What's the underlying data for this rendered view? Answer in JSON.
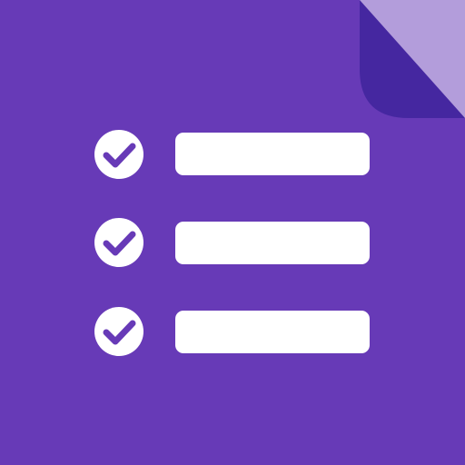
{
  "app_icon": {
    "icon_name": "forms-checklist-icon",
    "colors": {
      "background": "#673AB7",
      "fold_light": "#B39DDB",
      "fold_dark": "#4527A0",
      "foreground": "#FFFFFF",
      "checkmark": "#673AB7"
    },
    "checklist_rows": [
      {
        "checked": true
      },
      {
        "checked": true
      },
      {
        "checked": true
      }
    ]
  }
}
